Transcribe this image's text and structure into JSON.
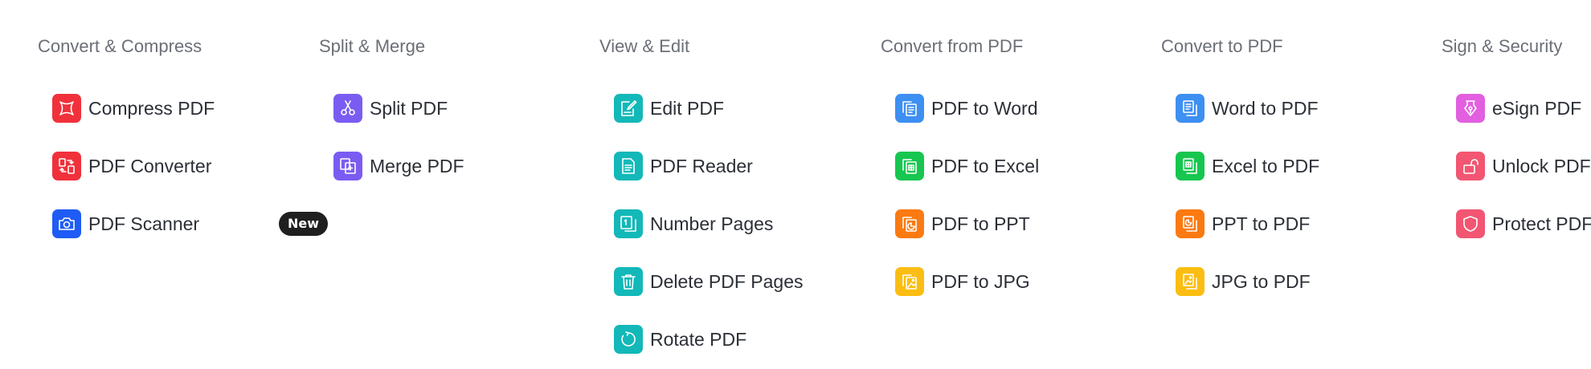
{
  "columns": [
    {
      "heading": "Convert & Compress",
      "items": [
        {
          "label": "Compress PDF",
          "icon": "compress-icon",
          "color": "#f0313b"
        },
        {
          "label": "PDF Converter",
          "icon": "convert-arrows-icon",
          "color": "#f0313b"
        },
        {
          "label": "PDF Scanner",
          "icon": "camera-icon",
          "color": "#1f5cf5",
          "badge": "New"
        }
      ]
    },
    {
      "heading": "Split & Merge",
      "items": [
        {
          "label": "Split PDF",
          "icon": "scissors-icon",
          "color": "#7a5cf2"
        },
        {
          "label": "Merge PDF",
          "icon": "merge-icon",
          "color": "#7a5cf2"
        }
      ]
    },
    {
      "heading": "View & Edit",
      "items": [
        {
          "label": "Edit PDF",
          "icon": "edit-icon",
          "color": "#13b8b8"
        },
        {
          "label": "PDF Reader",
          "icon": "reader-icon",
          "color": "#13b8b8"
        },
        {
          "label": "Number Pages",
          "icon": "number-pages-icon",
          "color": "#13b8b8"
        },
        {
          "label": "Delete PDF Pages",
          "icon": "trash-icon",
          "color": "#13b8b8"
        },
        {
          "label": "Rotate PDF",
          "icon": "rotate-icon",
          "color": "#13b8b8"
        }
      ]
    },
    {
      "heading": "Convert from PDF",
      "items": [
        {
          "label": "PDF to Word",
          "icon": "word-doc-icon",
          "color": "#3d8ff2"
        },
        {
          "label": "PDF to Excel",
          "icon": "excel-doc-icon",
          "color": "#16c64f"
        },
        {
          "label": "PDF to PPT",
          "icon": "ppt-doc-icon",
          "color": "#fb7a11"
        },
        {
          "label": "PDF to JPG",
          "icon": "image-doc-icon",
          "color": "#fbbd12"
        }
      ]
    },
    {
      "heading": "Convert to PDF",
      "items": [
        {
          "label": "Word to PDF",
          "icon": "word-doc-icon",
          "color": "#3d8ff2"
        },
        {
          "label": "Excel to PDF",
          "icon": "excel-doc-icon",
          "color": "#16c64f"
        },
        {
          "label": "PPT to PDF",
          "icon": "ppt-doc-icon",
          "color": "#fb7a11"
        },
        {
          "label": "JPG to PDF",
          "icon": "image-doc-icon",
          "color": "#fbbd12"
        }
      ]
    },
    {
      "heading": "Sign & Security",
      "items": [
        {
          "label": "eSign PDF",
          "icon": "pen-nib-icon",
          "color": "#e25fe0"
        },
        {
          "label": "Unlock PDF",
          "icon": "unlock-icon",
          "color": "#f25672"
        },
        {
          "label": "Protect PDF",
          "icon": "shield-icon",
          "color": "#f25672"
        }
      ]
    }
  ]
}
